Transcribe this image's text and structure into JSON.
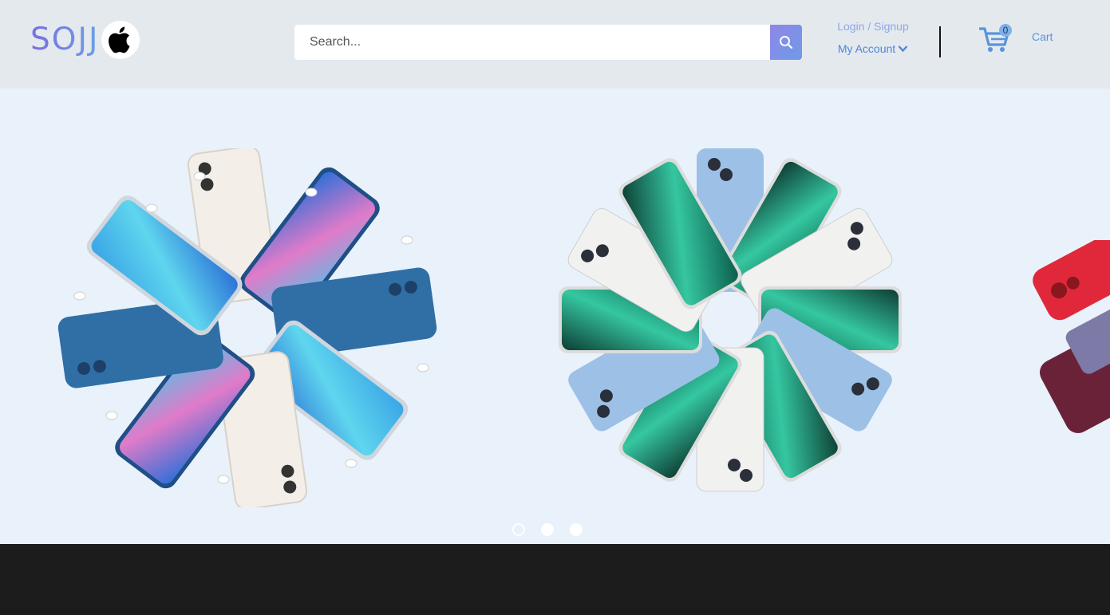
{
  "brand": {
    "logo_text": "SOJJ",
    "logo_icon": "apple-icon"
  },
  "search": {
    "placeholder": "Search...",
    "value": "",
    "button_icon": "search-icon"
  },
  "account": {
    "login_label": "Login / Signup",
    "my_account_label": "My Account",
    "dropdown_icon": "chevron-down-icon"
  },
  "cart": {
    "count": "0",
    "label": "Cart",
    "icon": "cart-icon"
  },
  "carousel": {
    "slides": [
      {
        "name": "iPhone 13 pinwheel with AirPods"
      },
      {
        "name": "iPhone 13 Pro pinwheel"
      },
      {
        "name": "iPhone case collection"
      }
    ],
    "active_index": 0
  },
  "colors": {
    "header_bg": "#e4e9ee",
    "hero_bg": "#e9f1fb",
    "accent": "#7d8ee6",
    "link": "#5a93da",
    "footer_bg": "#1c1c1c"
  }
}
